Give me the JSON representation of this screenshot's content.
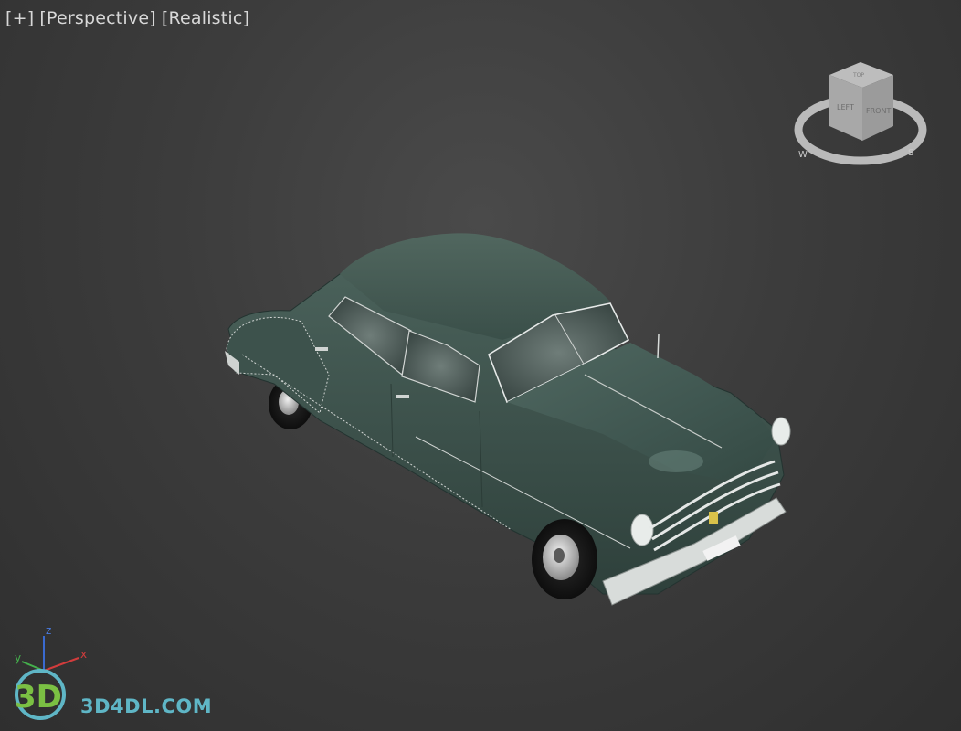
{
  "viewport": {
    "plus_label": "[+]",
    "view_label": "[Perspective]",
    "shading_label": "[Realistic]"
  },
  "viewcube": {
    "face_front": "FRONT",
    "face_left": "LEFT",
    "face_top": "TOP",
    "compass_w": "W",
    "compass_s": "S"
  },
  "axes": {
    "x": "x",
    "y": "y",
    "z": "z"
  },
  "watermark": {
    "logo": "3D",
    "text": "3D4DL.COM"
  },
  "colors": {
    "car_body": "#3e5650",
    "chrome": "#d8dcda",
    "axis_x": "#d23c3c",
    "axis_y": "#44b04c",
    "axis_z": "#3a6ad0",
    "watermark": "#5fb6c6"
  }
}
